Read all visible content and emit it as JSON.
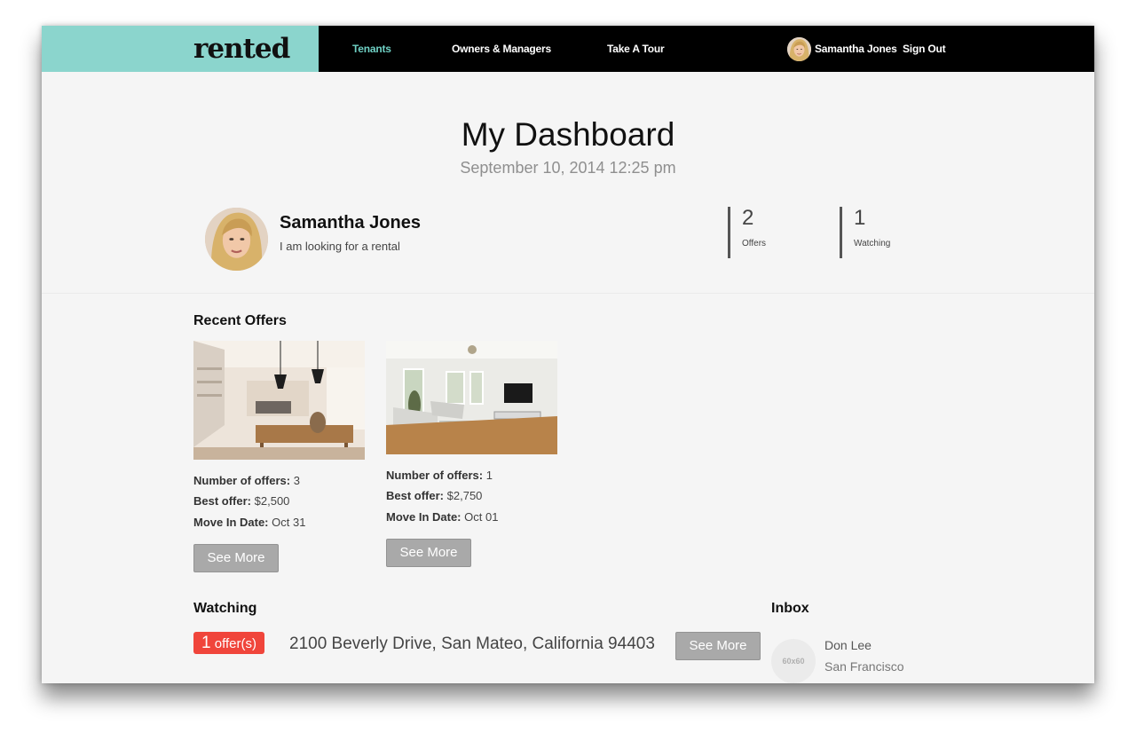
{
  "nav": {
    "brand": "rented",
    "links": [
      "Tenants",
      "Owners & Managers",
      "Take A Tour"
    ],
    "user_name": "Samantha Jones",
    "sign_out": "Sign Out",
    "accent_color": "#8bd5cd"
  },
  "header": {
    "title": "My Dashboard",
    "datetime": "September 10, 2014 12:25 pm"
  },
  "profile": {
    "name": "Samantha Jones",
    "status": "I am looking for a rental"
  },
  "stats": [
    {
      "value": "2",
      "label": "Offers"
    },
    {
      "value": "1",
      "label": "Watching"
    }
  ],
  "recent_offers": {
    "heading": "Recent Offers",
    "items": [
      {
        "offers_label": "Number of offers:",
        "offers_value": "3",
        "best_label": "Best offer:",
        "best_value": "$2,500",
        "move_label": "Move In Date:",
        "move_value": "Oct 31",
        "button": "See More"
      },
      {
        "offers_label": "Number of offers:",
        "offers_value": "1",
        "best_label": "Best offer:",
        "best_value": "$2,750",
        "move_label": "Move In Date:",
        "move_value": "Oct 01",
        "button": "See More"
      }
    ]
  },
  "watching": {
    "heading": "Watching",
    "badge_count": "1",
    "badge_text": "offer(s)",
    "address": "2100 Beverly Drive, San Mateo, California 94403",
    "button": "See More",
    "badge_color": "#f0453b"
  },
  "inbox": {
    "heading": "Inbox",
    "thumb": "60x60",
    "name": "Don Lee",
    "city": "San Francisco"
  }
}
